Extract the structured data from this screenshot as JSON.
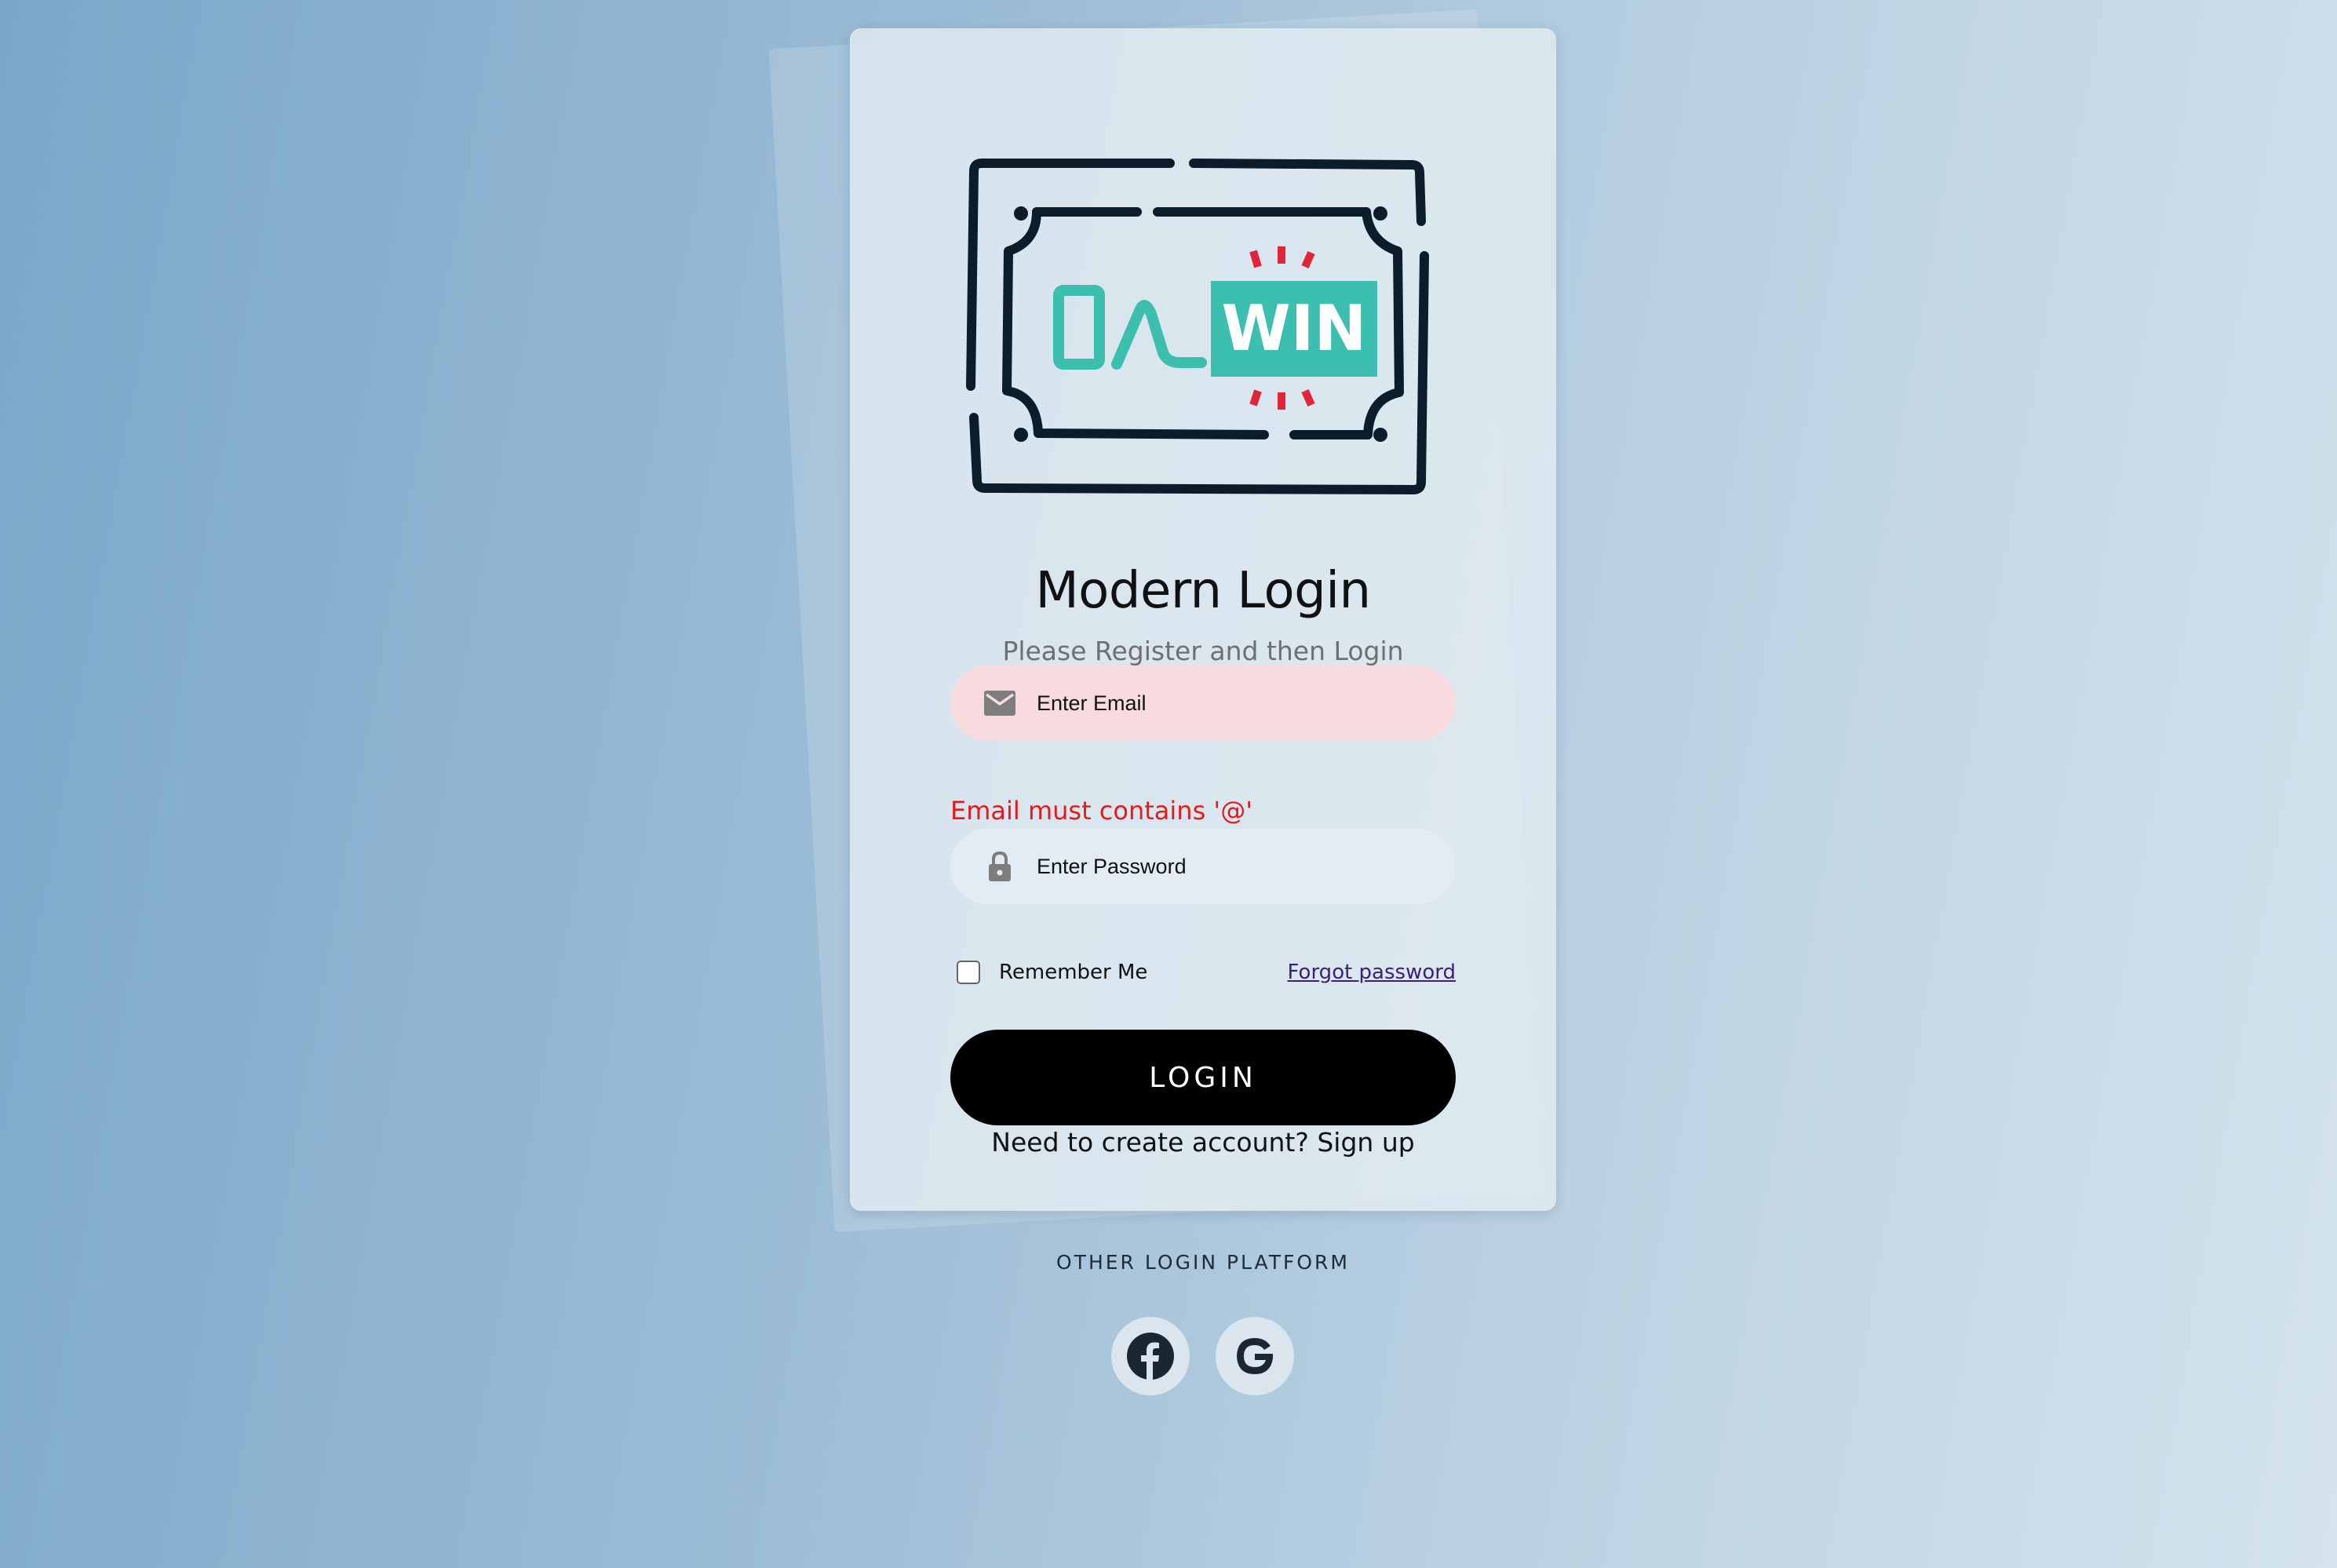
{
  "logo": {
    "left_text": "0",
    "right_text": "WIN",
    "accent_color": "#3cbfae",
    "spark_color": "#e2243b",
    "frame_color": "#0b1d2a"
  },
  "login": {
    "title": "Modern Login",
    "subtitle": "Please Register and then Login",
    "email": {
      "placeholder": "Enter Email",
      "value": "",
      "icon": "mail-icon",
      "error": "Email must contains '@'"
    },
    "password": {
      "placeholder": "Enter Password",
      "value": "",
      "icon": "lock-icon"
    },
    "remember_label": "Remember Me",
    "remember_checked": false,
    "forgot_label": "Forgot password",
    "login_label": "LOGIN",
    "signup_text": "Need to create account? Sign up"
  },
  "other": {
    "heading": "OTHER LOGIN PLATFORM",
    "platforms": [
      {
        "name": "facebook",
        "icon": "facebook-icon"
      },
      {
        "name": "google",
        "icon": "google-icon"
      }
    ]
  },
  "colors": {
    "error": "#e51a1a",
    "email_field_bg": "#f8dbdf",
    "password_field_bg": "#e3ecf4",
    "button_bg": "#000000",
    "link": "#3b1f7a"
  }
}
